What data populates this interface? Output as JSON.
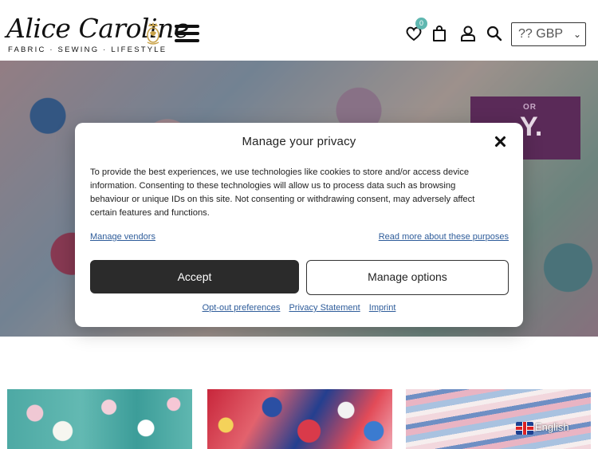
{
  "header": {
    "logo_script": "Alice Caroline",
    "logo_tagline": "FABRIC · SEWING · LIFESTYLE",
    "wishlist_count": "0",
    "currency_label": "GBP",
    "currency_flag_glyph": "??"
  },
  "hero": {
    "promo_small": "OR",
    "promo_big": "Y."
  },
  "consent": {
    "title": "Manage your privacy",
    "body": "To provide the best experiences, we use technologies like cookies to store and/or access device information. Consenting to these technologies will allow us to process data such as browsing behaviour or unique IDs on this site. Not consenting or withdrawing consent, may adversely affect certain features and functions.",
    "manage_vendors": "Manage vendors",
    "read_more": "Read more about these purposes",
    "accept_label": "Accept",
    "manage_options_label": "Manage options",
    "footer_links": [
      "Opt-out preferences",
      "Privacy Statement",
      "Imprint"
    ]
  },
  "language": {
    "label": "English"
  },
  "colors": {
    "accent": "#5fb7b0",
    "promo": "#5a2a58",
    "button_dark": "#2b2b2b",
    "link": "#2e5c9a"
  },
  "icons": [
    "menu-icon",
    "heart-icon",
    "bag-icon",
    "user-icon",
    "search-icon",
    "close-icon",
    "chevron-down-icon",
    "crest-icon",
    "uk-flag-icon"
  ]
}
